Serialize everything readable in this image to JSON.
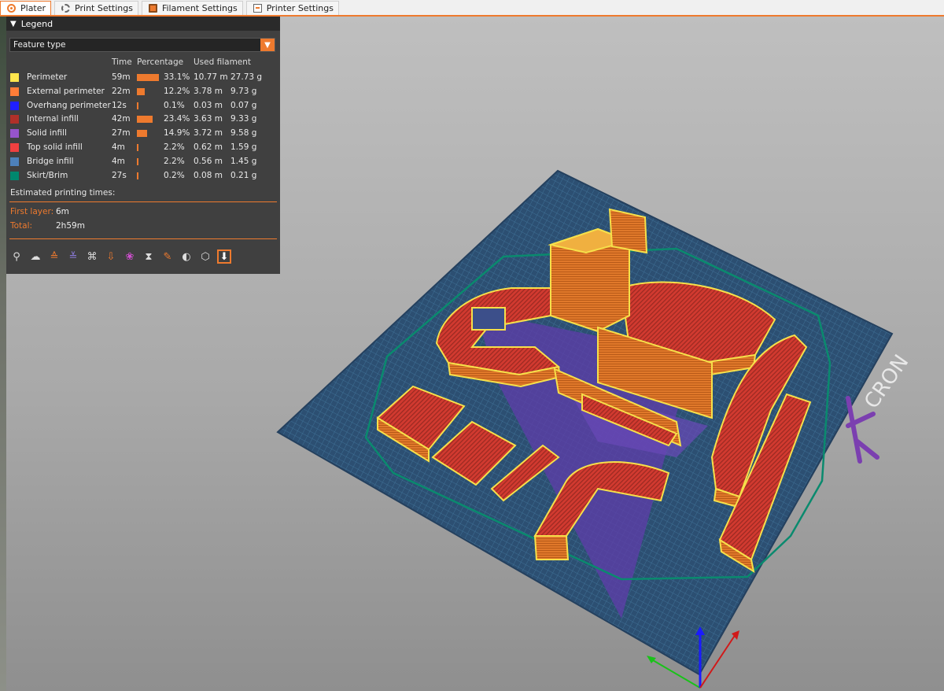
{
  "tabs": [
    {
      "label": "Plater",
      "icon": "plater-icon",
      "active": true
    },
    {
      "label": "Print Settings",
      "icon": "print-settings-icon",
      "active": false
    },
    {
      "label": "Filament Settings",
      "icon": "filament-icon",
      "active": false
    },
    {
      "label": "Printer Settings",
      "icon": "printer-icon",
      "active": false
    }
  ],
  "legend": {
    "title": "Legend",
    "view_type": "Feature type",
    "columns": {
      "time": "Time",
      "percentage": "Percentage",
      "used_filament": "Used filament"
    },
    "rows": [
      {
        "name": "Perimeter",
        "color": "#ffe64d",
        "time": "59m",
        "percent": "33.1%",
        "pct_value": 33.1,
        "length": "10.77 m",
        "weight": "27.73 g"
      },
      {
        "name": "External perimeter",
        "color": "#ff7d38",
        "time": "22m",
        "percent": "12.2%",
        "pct_value": 12.2,
        "length": "3.78 m",
        "weight": "9.73 g"
      },
      {
        "name": "Overhang perimeter",
        "color": "#1f1fff",
        "time": "12s",
        "percent": "0.1%",
        "pct_value": 0.1,
        "length": "0.03 m",
        "weight": "0.07 g"
      },
      {
        "name": "Internal infill",
        "color": "#b03029",
        "time": "42m",
        "percent": "23.4%",
        "pct_value": 23.4,
        "length": "3.63 m",
        "weight": "9.33 g"
      },
      {
        "name": "Solid infill",
        "color": "#9654cc",
        "time": "27m",
        "percent": "14.9%",
        "pct_value": 14.9,
        "length": "3.72 m",
        "weight": "9.58 g"
      },
      {
        "name": "Top solid infill",
        "color": "#f04040",
        "time": "4m",
        "percent": "2.2%",
        "pct_value": 2.2,
        "length": "0.62 m",
        "weight": "1.59 g"
      },
      {
        "name": "Bridge infill",
        "color": "#4d80ba",
        "time": "4m",
        "percent": "2.2%",
        "pct_value": 2.2,
        "length": "0.56 m",
        "weight": "1.45 g"
      },
      {
        "name": "Skirt/Brim",
        "color": "#00876e",
        "time": "27s",
        "percent": "0.2%",
        "pct_value": 0.2,
        "length": "0.08 m",
        "weight": "0.21 g"
      }
    ],
    "estimated_title": "Estimated printing times:",
    "times": [
      {
        "label": "First layer:",
        "value": "6m"
      },
      {
        "label": "Total:",
        "value": "2h59m"
      }
    ],
    "toolbar_icons": [
      "travel-icon",
      "wipe-icon",
      "retractions-icon",
      "deretractions-icon",
      "seams-icon",
      "tool-changes-icon",
      "color-changes-icon",
      "pause-prints-icon",
      "custom-gcodes-icon",
      "center-of-gravity-icon",
      "shells-icon",
      "tool-marker-icon"
    ]
  },
  "bed_logo": "CRON",
  "accent": "#ee7a2e"
}
